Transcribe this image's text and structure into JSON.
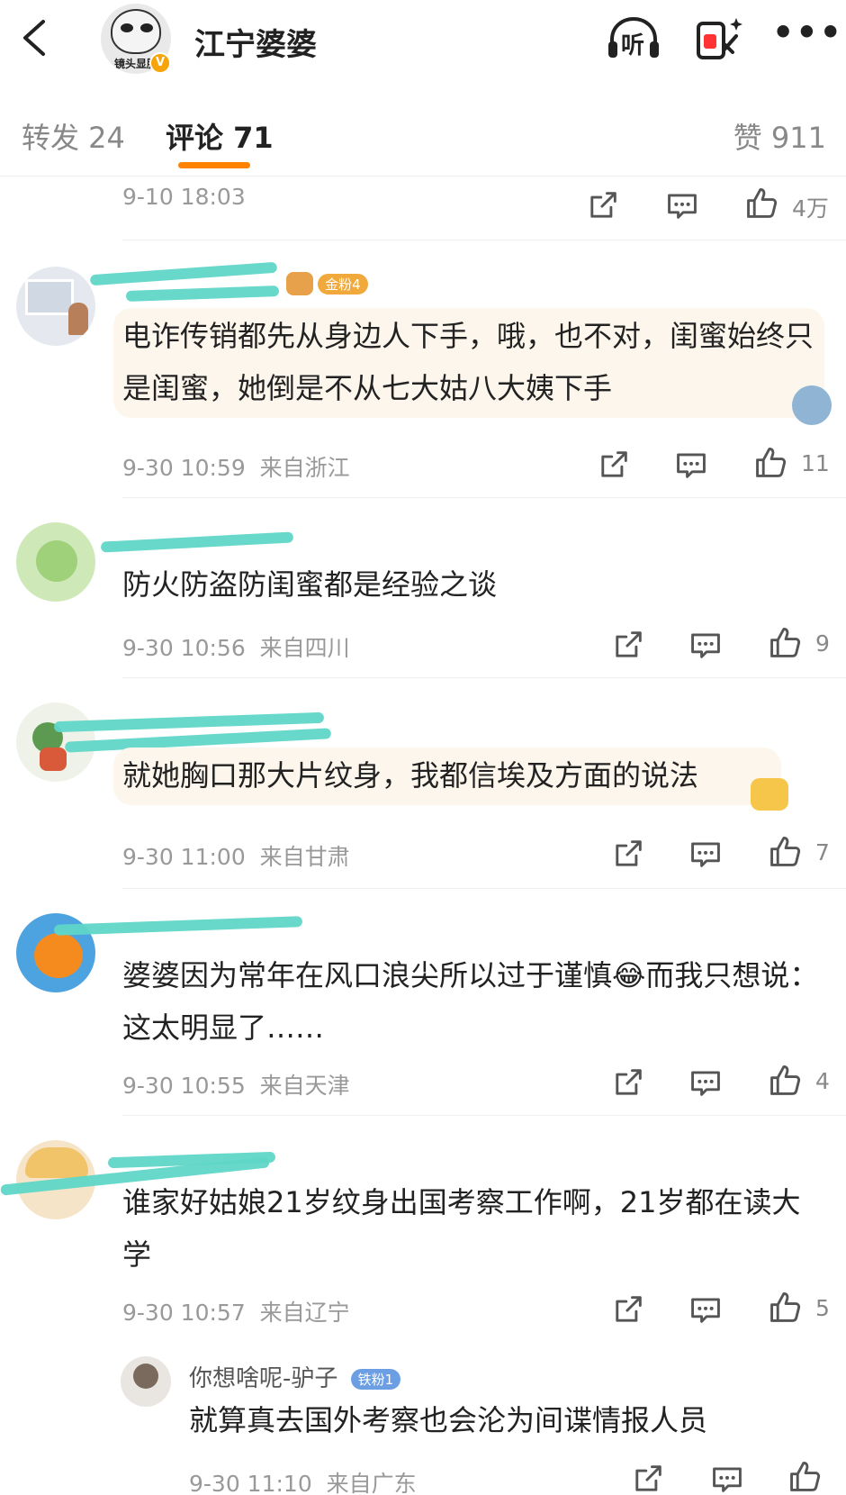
{
  "header": {
    "back_icon": "chevron-left-icon",
    "avatar_caption": "镜头显脸",
    "verify_mark": "V",
    "title": "江宁婆婆",
    "listen_label": "听",
    "more_label": "•••"
  },
  "tabs": {
    "repost": "转发 24",
    "comment": "评论 71",
    "like": "赞 911"
  },
  "top_row": {
    "time": "9-10 18:03",
    "likes": "4万"
  },
  "comments": [
    {
      "badge": "金粉4",
      "text": "电诈传销都先从身边人下手，哦，也不对，闺蜜始终只是闺蜜，她倒是不从七大姑八大姨下手",
      "time": "9-30 10:59",
      "location": "来自浙江",
      "likes": "11"
    },
    {
      "text": "防火防盗防闺蜜都是经验之谈",
      "time": "9-30 10:56",
      "location": "来自四川",
      "likes": "9"
    },
    {
      "text": "就她胸口那大片纹身，我都信埃及方面的说法",
      "time": "9-30 11:00",
      "location": "来自甘肃",
      "likes": "7"
    },
    {
      "text": "婆婆因为常年在风口浪尖所以过于谨慎😂而我只想说：这太明显了……",
      "time": "9-30 10:55",
      "location": "来自天津",
      "likes": "4"
    },
    {
      "text": "谁家好姑娘21岁纹身出国考察工作啊，21岁都在读大学",
      "time": "9-30 10:57",
      "location": "来自辽宁",
      "likes": "5"
    }
  ],
  "reply": {
    "name": "你想啥呢-驴子",
    "badge": "铁粉1",
    "text": "就算真去国外考察也会沦为间谍情报人员",
    "time": "9-30 11:10",
    "location": "来自广东"
  },
  "colors": {
    "accent": "#ff8200",
    "scribble": "#5fd6c7",
    "meta": "#999999"
  },
  "icons": [
    "share-icon",
    "comment-icon",
    "thumb-up-icon"
  ]
}
